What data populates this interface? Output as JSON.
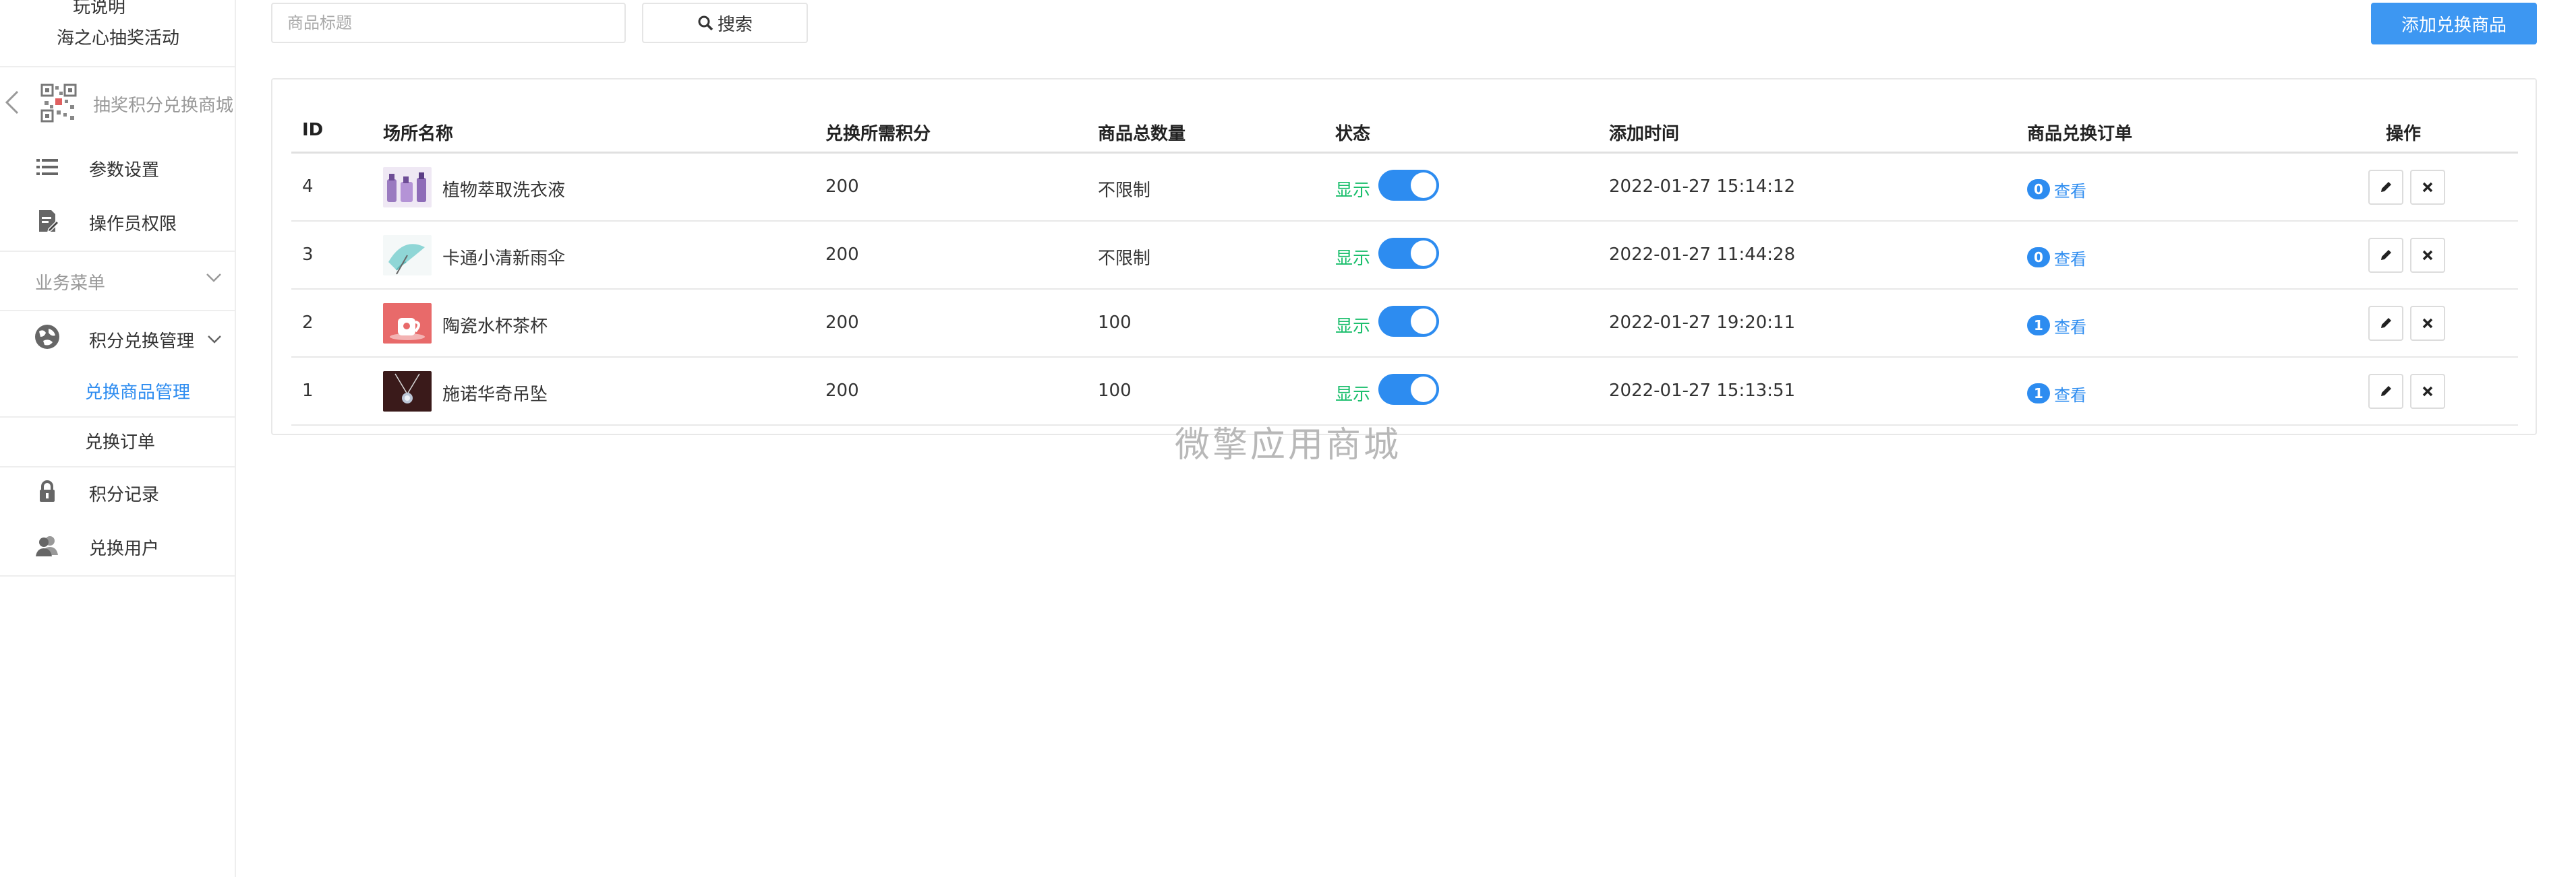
{
  "sidebar": {
    "top_cut_text": "玩说明",
    "app_name": "海之心抽奖活动",
    "mall_name": "抽奖积分兑换商城",
    "items": [
      {
        "label": "参数设置",
        "icon": "list-icon"
      },
      {
        "label": "操作员权限",
        "icon": "document-edit-icon"
      }
    ],
    "group_label": "业务菜单",
    "group_item": {
      "label": "积分兑换管理",
      "icon": "globe-icon"
    },
    "sub_items": [
      {
        "label": "兑换商品管理",
        "active": true
      },
      {
        "label": "兑换订单",
        "active": false
      }
    ],
    "bottom_items": [
      {
        "label": "积分记录",
        "icon": "lock-icon"
      },
      {
        "label": "兑换用户",
        "icon": "users-icon"
      }
    ]
  },
  "toolbar": {
    "search_placeholder": "商品标题",
    "search_value": "",
    "search_label": "搜索",
    "add_label": "添加兑换商品"
  },
  "table": {
    "headers": {
      "id": "ID",
      "name": "场所名称",
      "points": "兑换所需积分",
      "quantity": "商品总数量",
      "status": "状态",
      "added": "添加时间",
      "orders": "商品兑换订单",
      "actions": "操作"
    },
    "rows": [
      {
        "id": "4",
        "name": "植物萃取洗衣液",
        "points": "200",
        "quantity": "不限制",
        "status": "显示",
        "enabled": true,
        "added": "2022-01-27 15:14:12",
        "order_count": "0",
        "view": "查看",
        "thumb": "detergent"
      },
      {
        "id": "3",
        "name": "卡通小清新雨伞",
        "points": "200",
        "quantity": "不限制",
        "status": "显示",
        "enabled": true,
        "added": "2022-01-27 11:44:28",
        "order_count": "0",
        "view": "查看",
        "thumb": "umbrella"
      },
      {
        "id": "2",
        "name": "陶瓷水杯茶杯",
        "points": "200",
        "quantity": "100",
        "status": "显示",
        "enabled": true,
        "added": "2022-01-27 19:20:11",
        "order_count": "1",
        "view": "查看",
        "thumb": "cup"
      },
      {
        "id": "1",
        "name": "施诺华奇吊坠",
        "points": "200",
        "quantity": "100",
        "status": "显示",
        "enabled": true,
        "added": "2022-01-27 15:13:51",
        "order_count": "1",
        "view": "查看",
        "thumb": "pendant"
      }
    ]
  },
  "watermark": "微擎应用商城",
  "colors": {
    "primary": "#2d8cf0",
    "add_button": "#3d97f2",
    "status_green": "#19be6b",
    "muted": "#999999"
  }
}
